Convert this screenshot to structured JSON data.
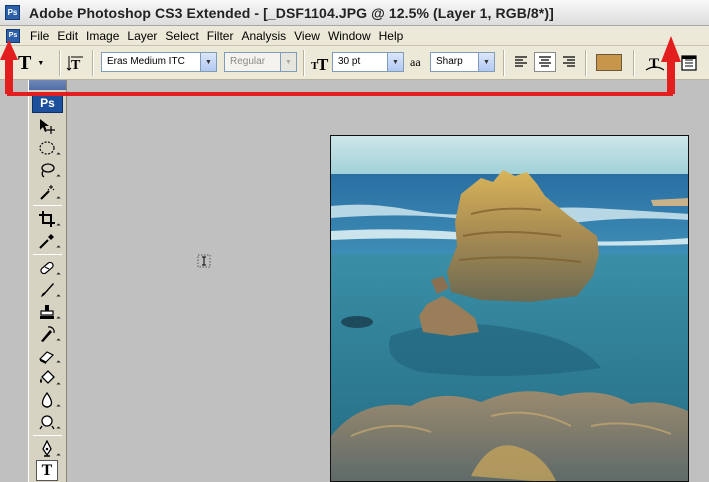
{
  "window": {
    "app_icon": "Ps",
    "title": "Adobe Photoshop CS3 Extended - [_DSF1104.JPG @ 12.5% (Layer 1, RGB/8*)]"
  },
  "menubar": {
    "doc_icon": "Ps",
    "items": [
      "File",
      "Edit",
      "Image",
      "Layer",
      "Select",
      "Filter",
      "Analysis",
      "View",
      "Window",
      "Help"
    ]
  },
  "options": {
    "tool_glyph": "T",
    "font_family": "Eras Medium ITC",
    "font_style": "Regular",
    "font_size": "30 pt",
    "aa_glyph": "aa",
    "antialias": "Sharp",
    "text_color": "#c8964a",
    "size_glyph": "T"
  },
  "toolbox": {
    "logo": "Ps",
    "selected_tool_glyph": "T"
  },
  "colors": {
    "accent": "#e31e1e",
    "brand": "#1c4f9c"
  },
  "icons": [
    "move-tool-icon",
    "marquee-tool-icon",
    "lasso-tool-icon",
    "magic-wand-icon",
    "crop-tool-icon",
    "eyedropper-icon",
    "healing-brush-icon",
    "brush-tool-icon",
    "clone-stamp-icon",
    "history-brush-icon",
    "eraser-icon",
    "paint-bucket-icon",
    "blur-tool-icon",
    "dodge-tool-icon",
    "pen-tool-icon",
    "type-tool-icon"
  ]
}
